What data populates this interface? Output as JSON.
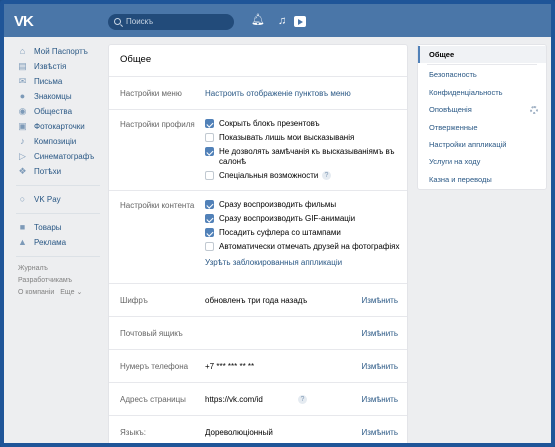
{
  "header": {
    "logo": "VK",
    "search_placeholder": "Поискъ"
  },
  "leftnav": {
    "items": [
      {
        "label": "Мой Паспортъ",
        "icon": "home-icon"
      },
      {
        "label": "Извѣстія",
        "icon": "news-icon"
      },
      {
        "label": "Письма",
        "icon": "messages-icon"
      },
      {
        "label": "Знакомцы",
        "icon": "friends-icon"
      },
      {
        "label": "Общества",
        "icon": "groups-icon"
      },
      {
        "label": "Фотокарточки",
        "icon": "photos-icon"
      },
      {
        "label": "Композиціи",
        "icon": "music-icon"
      },
      {
        "label": "Синематографъ",
        "icon": "video-icon"
      },
      {
        "label": "Потѣхи",
        "icon": "games-icon"
      }
    ],
    "pay": {
      "label": "VK Pay",
      "icon": "vkpay-icon"
    },
    "extra": [
      {
        "label": "Товары",
        "icon": "market-icon"
      },
      {
        "label": "Реклама",
        "icon": "ads-icon"
      }
    ],
    "footer": {
      "journal": "Журналъ",
      "developers": "Разработчикамъ",
      "about": "О компаніи",
      "more": "Еще ⌄"
    }
  },
  "main": {
    "title": "Общее",
    "menu_settings": {
      "label": "Настройки меню",
      "link": "Настроить отображеніе пунктовъ меню"
    },
    "profile_settings": {
      "label": "Настройки профиля",
      "options": [
        {
          "text": "Сокрыть блокъ презентовъ",
          "checked": true
        },
        {
          "text": "Показывать лишь мои высказыванія",
          "checked": false
        },
        {
          "text": "Не дозволять замѣчанія къ высказываніямъ въ",
          "text2": "салонѣ",
          "checked": true
        },
        {
          "text": "Спеціальныя возможности",
          "checked": false
        }
      ]
    },
    "content_settings": {
      "label": "Настройки контента",
      "options": [
        {
          "text": "Сразу воспроизводить фильмы",
          "checked": true
        },
        {
          "text": "Сразу воспроизводить GIF-анимаціи",
          "checked": true
        },
        {
          "text": "Посадить суфлера со штампами",
          "checked": true
        },
        {
          "text": "Автоматически отмечать друзей на фотографіях",
          "checked": false
        }
      ],
      "link": "Узрѣть заблокированныя аппликаціи"
    },
    "rows": {
      "password": {
        "label": "Шифръ",
        "value": "обновленъ три года назадъ",
        "action": "Измѣнить"
      },
      "email": {
        "label": "Почтовый ящикъ",
        "value": "",
        "action": "Измѣнить"
      },
      "phone": {
        "label": "Нумеръ телефона",
        "value": "+7 *** *** ** **",
        "action": "Измѣнить"
      },
      "address": {
        "label": "Адресъ страницы",
        "value": "https://vk.com/id",
        "action": "Измѣнить"
      },
      "language": {
        "label": "Языкъ:",
        "value": "Дореволюціонный",
        "action": "Измѣнить"
      }
    }
  },
  "rmenu": {
    "items": [
      {
        "label": "Общее",
        "active": true
      },
      {
        "label": "Безопасность"
      },
      {
        "label": "Конфиденціальность"
      },
      {
        "label": "Оповѣщенія"
      },
      {
        "label": "Отверженные"
      },
      {
        "label": "Настройки аппликацій"
      },
      {
        "label": "Услуги на ходу"
      },
      {
        "label": "Казна и переводы"
      }
    ]
  }
}
